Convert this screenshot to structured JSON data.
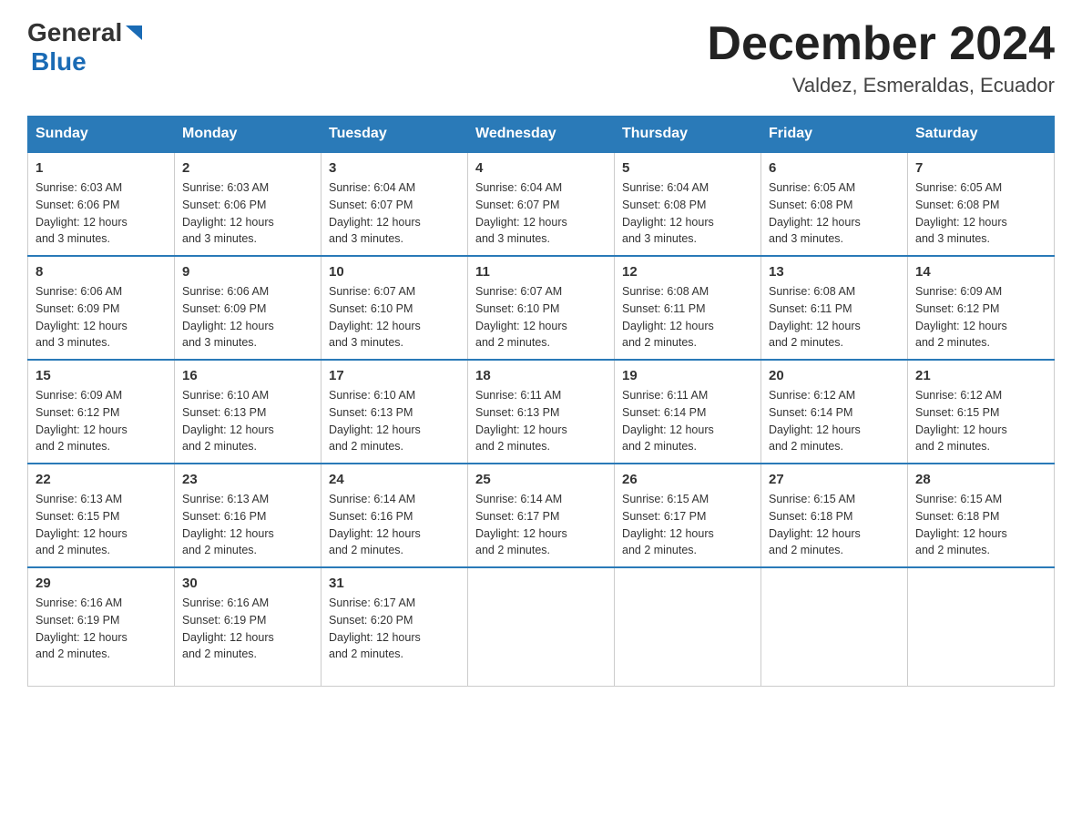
{
  "header": {
    "logo_text_black": "General",
    "logo_text_blue": "Blue",
    "month_title": "December 2024",
    "location": "Valdez, Esmeraldas, Ecuador"
  },
  "days_of_week": [
    "Sunday",
    "Monday",
    "Tuesday",
    "Wednesday",
    "Thursday",
    "Friday",
    "Saturday"
  ],
  "weeks": [
    [
      {
        "day": "1",
        "sunrise": "6:03 AM",
        "sunset": "6:06 PM",
        "daylight": "12 hours and 3 minutes."
      },
      {
        "day": "2",
        "sunrise": "6:03 AM",
        "sunset": "6:06 PM",
        "daylight": "12 hours and 3 minutes."
      },
      {
        "day": "3",
        "sunrise": "6:04 AM",
        "sunset": "6:07 PM",
        "daylight": "12 hours and 3 minutes."
      },
      {
        "day": "4",
        "sunrise": "6:04 AM",
        "sunset": "6:07 PM",
        "daylight": "12 hours and 3 minutes."
      },
      {
        "day": "5",
        "sunrise": "6:04 AM",
        "sunset": "6:08 PM",
        "daylight": "12 hours and 3 minutes."
      },
      {
        "day": "6",
        "sunrise": "6:05 AM",
        "sunset": "6:08 PM",
        "daylight": "12 hours and 3 minutes."
      },
      {
        "day": "7",
        "sunrise": "6:05 AM",
        "sunset": "6:08 PM",
        "daylight": "12 hours and 3 minutes."
      }
    ],
    [
      {
        "day": "8",
        "sunrise": "6:06 AM",
        "sunset": "6:09 PM",
        "daylight": "12 hours and 3 minutes."
      },
      {
        "day": "9",
        "sunrise": "6:06 AM",
        "sunset": "6:09 PM",
        "daylight": "12 hours and 3 minutes."
      },
      {
        "day": "10",
        "sunrise": "6:07 AM",
        "sunset": "6:10 PM",
        "daylight": "12 hours and 3 minutes."
      },
      {
        "day": "11",
        "sunrise": "6:07 AM",
        "sunset": "6:10 PM",
        "daylight": "12 hours and 2 minutes."
      },
      {
        "day": "12",
        "sunrise": "6:08 AM",
        "sunset": "6:11 PM",
        "daylight": "12 hours and 2 minutes."
      },
      {
        "day": "13",
        "sunrise": "6:08 AM",
        "sunset": "6:11 PM",
        "daylight": "12 hours and 2 minutes."
      },
      {
        "day": "14",
        "sunrise": "6:09 AM",
        "sunset": "6:12 PM",
        "daylight": "12 hours and 2 minutes."
      }
    ],
    [
      {
        "day": "15",
        "sunrise": "6:09 AM",
        "sunset": "6:12 PM",
        "daylight": "12 hours and 2 minutes."
      },
      {
        "day": "16",
        "sunrise": "6:10 AM",
        "sunset": "6:13 PM",
        "daylight": "12 hours and 2 minutes."
      },
      {
        "day": "17",
        "sunrise": "6:10 AM",
        "sunset": "6:13 PM",
        "daylight": "12 hours and 2 minutes."
      },
      {
        "day": "18",
        "sunrise": "6:11 AM",
        "sunset": "6:13 PM",
        "daylight": "12 hours and 2 minutes."
      },
      {
        "day": "19",
        "sunrise": "6:11 AM",
        "sunset": "6:14 PM",
        "daylight": "12 hours and 2 minutes."
      },
      {
        "day": "20",
        "sunrise": "6:12 AM",
        "sunset": "6:14 PM",
        "daylight": "12 hours and 2 minutes."
      },
      {
        "day": "21",
        "sunrise": "6:12 AM",
        "sunset": "6:15 PM",
        "daylight": "12 hours and 2 minutes."
      }
    ],
    [
      {
        "day": "22",
        "sunrise": "6:13 AM",
        "sunset": "6:15 PM",
        "daylight": "12 hours and 2 minutes."
      },
      {
        "day": "23",
        "sunrise": "6:13 AM",
        "sunset": "6:16 PM",
        "daylight": "12 hours and 2 minutes."
      },
      {
        "day": "24",
        "sunrise": "6:14 AM",
        "sunset": "6:16 PM",
        "daylight": "12 hours and 2 minutes."
      },
      {
        "day": "25",
        "sunrise": "6:14 AM",
        "sunset": "6:17 PM",
        "daylight": "12 hours and 2 minutes."
      },
      {
        "day": "26",
        "sunrise": "6:15 AM",
        "sunset": "6:17 PM",
        "daylight": "12 hours and 2 minutes."
      },
      {
        "day": "27",
        "sunrise": "6:15 AM",
        "sunset": "6:18 PM",
        "daylight": "12 hours and 2 minutes."
      },
      {
        "day": "28",
        "sunrise": "6:15 AM",
        "sunset": "6:18 PM",
        "daylight": "12 hours and 2 minutes."
      }
    ],
    [
      {
        "day": "29",
        "sunrise": "6:16 AM",
        "sunset": "6:19 PM",
        "daylight": "12 hours and 2 minutes."
      },
      {
        "day": "30",
        "sunrise": "6:16 AM",
        "sunset": "6:19 PM",
        "daylight": "12 hours and 2 minutes."
      },
      {
        "day": "31",
        "sunrise": "6:17 AM",
        "sunset": "6:20 PM",
        "daylight": "12 hours and 2 minutes."
      },
      null,
      null,
      null,
      null
    ]
  ],
  "labels": {
    "sunrise": "Sunrise:",
    "sunset": "Sunset:",
    "daylight": "Daylight:"
  }
}
